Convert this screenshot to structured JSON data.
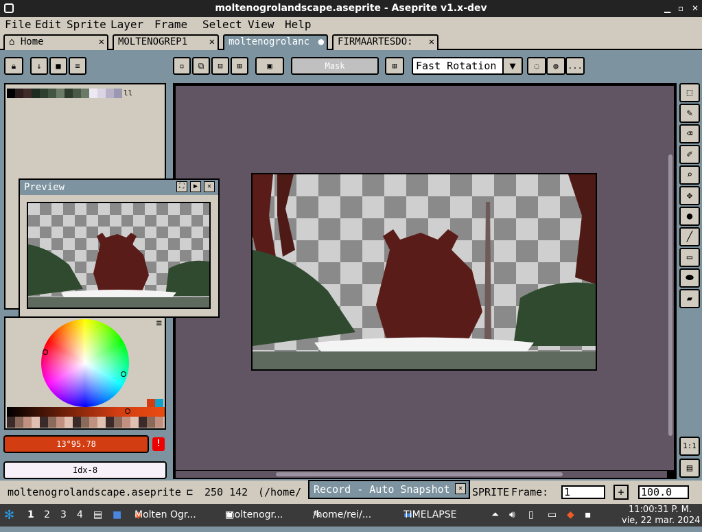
{
  "window": {
    "title": "moltenogrolandscape.aseprite - Aseprite v1.x-dev"
  },
  "menu": [
    "File",
    "Edit",
    "Sprite",
    "Layer",
    "Frame",
    "Select",
    "View",
    "Help"
  ],
  "tabs": [
    {
      "label": "Home",
      "close": "✕"
    },
    {
      "label": "MOLTENOGREP1",
      "close": "✕"
    },
    {
      "label": "moltenogrolanc",
      "close": "●"
    },
    {
      "label": "FIRMAARTESDO:",
      "close": "✕"
    }
  ],
  "toolbar": {
    "mask_label": "Mask",
    "rotation_select": "Fast Rotation",
    "more": "..."
  },
  "preview": {
    "title": "Preview"
  },
  "color": {
    "rgb_value": "13°95.78",
    "index_value": "Idx-8",
    "warning": "!"
  },
  "status": {
    "filename": "moltenogrolandscape.aseprite",
    "coords": "250 142",
    "path": "(/home/",
    "sprite_label": "SPRITE",
    "frame_label": "Frame:",
    "frame_value": "1",
    "zoom_value": "100.0"
  },
  "record": {
    "label": "Record - Auto Snapshot"
  },
  "right_tools": {
    "ratio": "1:1"
  },
  "taskbar": {
    "workspaces": [
      "1",
      "2",
      "3",
      "4"
    ],
    "apps": [
      "Molten Ogr...",
      "moltenogr...",
      "/home/rei/...",
      "TIMELAPSE"
    ],
    "time": "11:00:31 P. M.",
    "date": "vie, 22 mar. 2024"
  }
}
